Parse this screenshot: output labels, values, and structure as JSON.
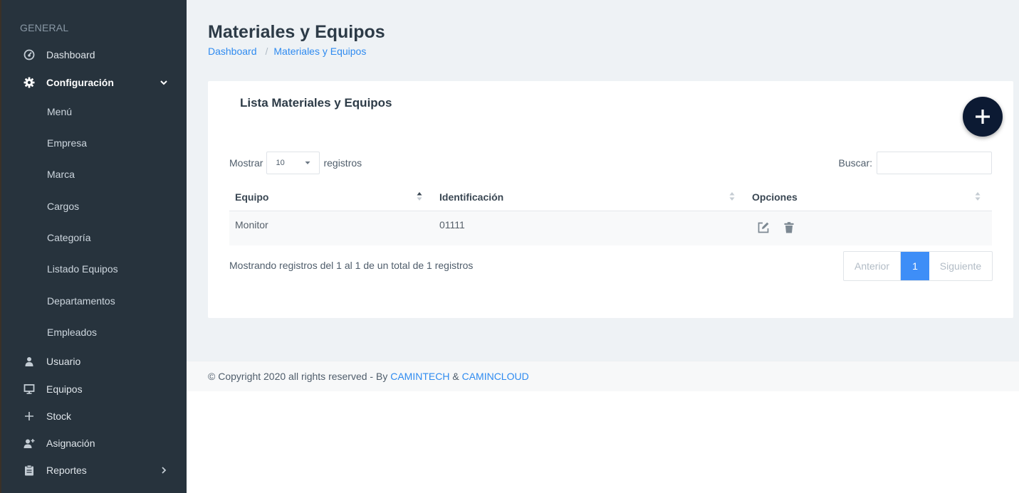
{
  "sidebar": {
    "section_label": "GENERAL",
    "items": [
      {
        "label": "Dashboard",
        "icon": "dashboard-icon"
      },
      {
        "label": "Configuración",
        "icon": "gear-icon"
      },
      {
        "label": "Usuario",
        "icon": "user-icon"
      },
      {
        "label": "Equipos",
        "icon": "monitor-icon"
      },
      {
        "label": "Stock",
        "icon": "plus-icon"
      },
      {
        "label": "Asignación",
        "icon": "user-plus-icon"
      },
      {
        "label": "Reportes",
        "icon": "clipboard-icon"
      }
    ],
    "config_subitems": [
      "Menú",
      "Empresa",
      "Marca",
      "Cargos",
      "Categoría",
      "Listado Equipos",
      "Departamentos",
      "Empleados"
    ]
  },
  "header": {
    "title": "Materiales y Equipos",
    "breadcrumb": [
      "Dashboard",
      "Materiales y Equipos"
    ]
  },
  "card": {
    "title": "Lista Materiales y Equipos",
    "show_label": "Mostrar",
    "show_value": "10",
    "records_label": "registros",
    "search_label": "Buscar:",
    "search_value": "",
    "columns": [
      "Equipo",
      "Identificación",
      "Opciones"
    ],
    "rows": [
      {
        "equipo": "Monitor",
        "identificacion": "01111"
      }
    ],
    "info": "Mostrando registros del 1 al 1 de un total de 1 registros",
    "pagination": {
      "prev": "Anterior",
      "current": "1",
      "next": "Siguiente"
    }
  },
  "footer": {
    "text": "© Copyright 2020 all rights reserved - By ",
    "link1": "CAMINTECH",
    "amp": " & ",
    "link2": "CAMINCLOUD"
  },
  "colors": {
    "sidebar_bg": "#27333d",
    "accent": "#3e8ef7",
    "link": "#2f8bf0",
    "fab_bg": "#0c1a33"
  }
}
